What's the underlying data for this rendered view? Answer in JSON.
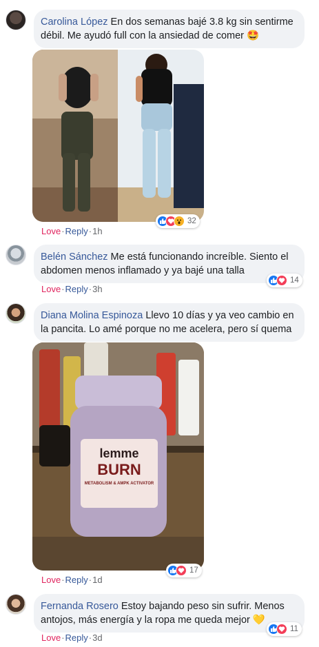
{
  "comments": [
    {
      "author": "Carolina López",
      "text": "En dos semanas bajé 3.8 kg sin sentirme débil. Me ayudó full con la ansiedad de comer 🤩",
      "actions": {
        "love": "Love",
        "reply": "Reply",
        "time": "1h"
      },
      "reaction_count": "32",
      "reactions": [
        "like-icon",
        "love-icon",
        "wow-icon"
      ]
    },
    {
      "author": "Belén Sánchez",
      "text": "Me está funcionando increíble. Siento el abdomen menos inflamado y ya bajé una talla",
      "actions": {
        "love": "Love",
        "reply": "Reply",
        "time": "3h"
      },
      "reaction_count": "14",
      "reactions": [
        "like-icon",
        "love-icon"
      ]
    },
    {
      "author": "Diana Molina Espinoza",
      "text": "Llevo 10 días y ya veo cambio en la pancita. Lo amé porque no me acelera, pero sí quema",
      "actions": {
        "love": "Love",
        "reply": "Reply",
        "time": "1d"
      },
      "reaction_count": "17",
      "reactions": [
        "like-icon",
        "love-icon"
      ],
      "product_label": {
        "brand": "lemme",
        "name": "BURN",
        "sub": "METABOLISM & AMPK ACTIVATOR"
      }
    },
    {
      "author": "Fernanda Rosero",
      "text": "Estoy bajando peso sin sufrir. Menos antojos, más energía y la ropa me queda mejor 💛",
      "actions": {
        "love": "Love",
        "reply": "Reply",
        "time": "3d"
      },
      "reaction_count": "11",
      "reactions": [
        "like-icon",
        "love-icon"
      ]
    }
  ],
  "colors": {
    "author": "#365899",
    "love": "#e0245e",
    "bubble": "#f0f2f5",
    "like": "#1877f2",
    "heart": "#f33e58"
  }
}
